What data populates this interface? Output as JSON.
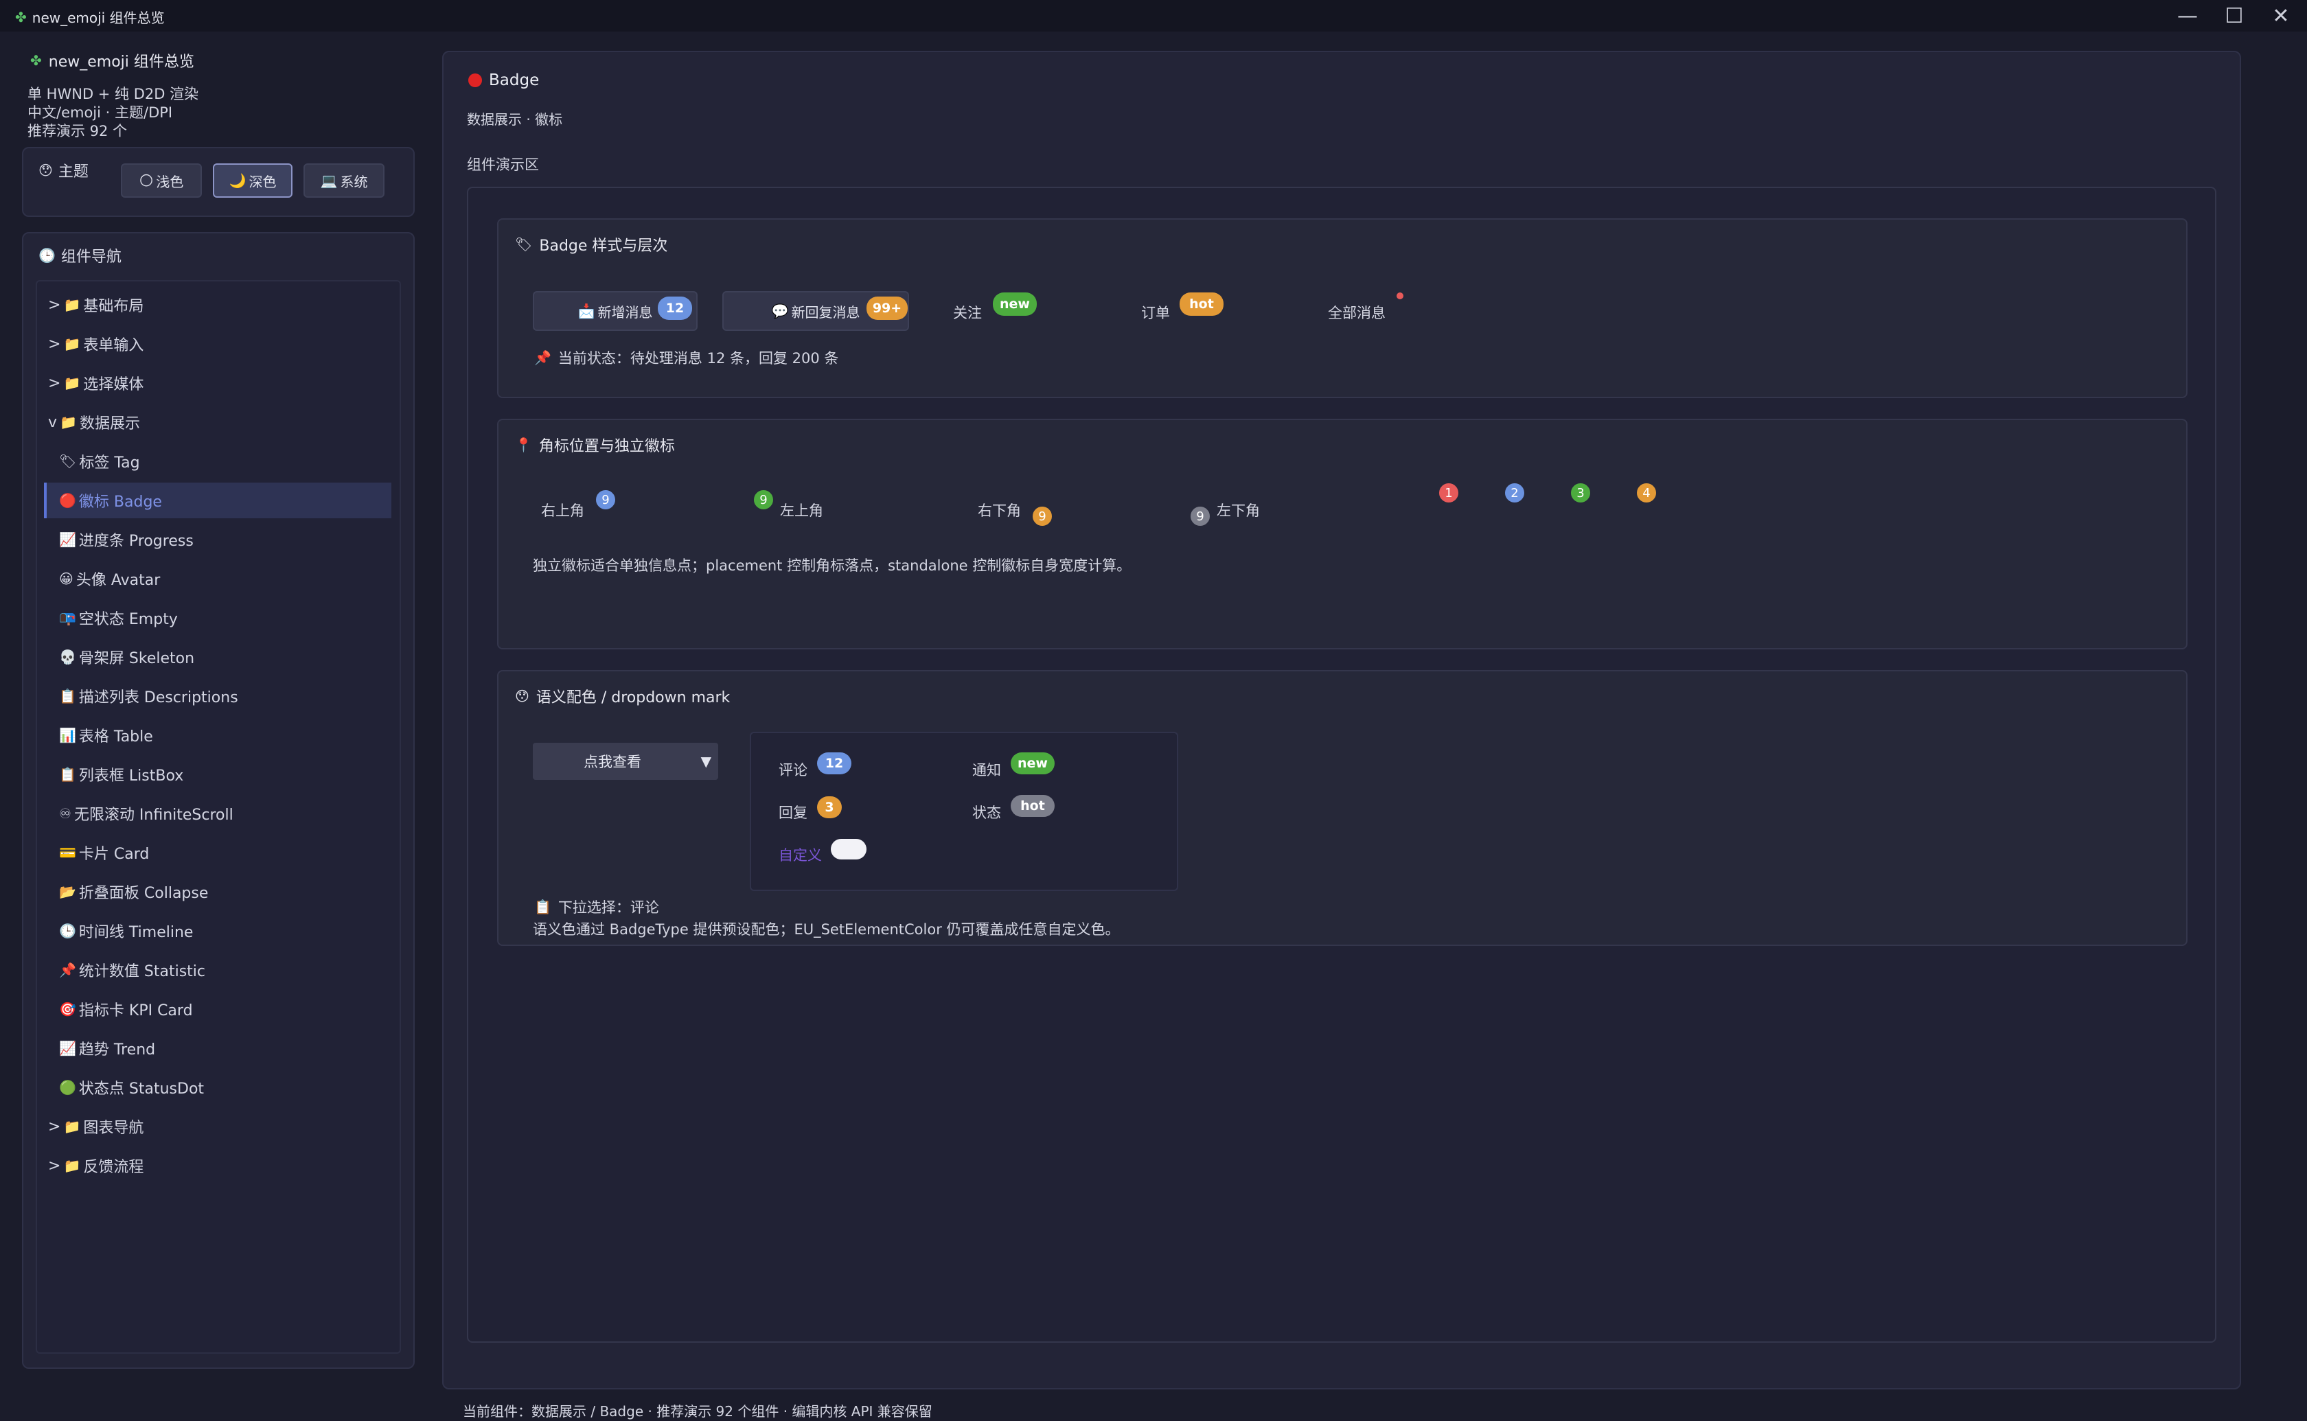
{
  "window": {
    "title": "new_emoji 组件总览",
    "controls": [
      "—",
      "☐",
      "✕"
    ]
  },
  "sidebar": {
    "app_title": "new_emoji 组件总览",
    "info_lines": [
      "单 HWND + 纯 D2D 渲染",
      "中文/emoji · 主题/DPI",
      "推荐演示 92 个"
    ],
    "theme": {
      "label": "主题",
      "options": [
        {
          "label": "浅色",
          "icon": "🌕"
        },
        {
          "label": "深色",
          "icon": "🌙"
        },
        {
          "label": "系统",
          "icon": "💻"
        }
      ],
      "selected": "深色"
    },
    "nav_title": "组件导航",
    "groups": [
      {
        "label": "基础布局",
        "prefix": ">"
      },
      {
        "label": "表单输入",
        "prefix": ">"
      },
      {
        "label": "选择媒体",
        "prefix": ">"
      },
      {
        "label": "数据展示",
        "prefix": "v"
      }
    ],
    "items": [
      {
        "icon": "🏷",
        "label": "标签 Tag"
      },
      {
        "icon": "🔴",
        "label": "徽标 Badge"
      },
      {
        "icon": "📈",
        "label": "进度条 Progress"
      },
      {
        "icon": "😀",
        "label": "头像 Avatar"
      },
      {
        "icon": "📭",
        "label": "空状态 Empty"
      },
      {
        "icon": "💀",
        "label": "骨架屏 Skeleton"
      },
      {
        "icon": "📋",
        "label": "描述列表 Descriptions"
      },
      {
        "icon": "📊",
        "label": "表格 Table"
      },
      {
        "icon": "📋",
        "label": "列表框 ListBox"
      },
      {
        "icon": "♾",
        "label": "无限滚动 InfiniteScroll"
      },
      {
        "icon": "💳",
        "label": "卡片 Card"
      },
      {
        "icon": "📂",
        "label": "折叠面板 Collapse"
      },
      {
        "icon": "🕒",
        "label": "时间线 Timeline"
      },
      {
        "icon": "📌",
        "label": "统计数值 Statistic"
      },
      {
        "icon": "🎯",
        "label": "指标卡 KPI Card"
      },
      {
        "icon": "📈",
        "label": "趋势 Trend"
      },
      {
        "icon": "🟢",
        "label": "状态点 StatusDot"
      }
    ],
    "tail_groups": [
      {
        "label": "图表导航",
        "prefix": ">"
      },
      {
        "label": "反馈流程",
        "prefix": ">"
      }
    ]
  },
  "main": {
    "title": "Badge",
    "subtitle": "数据展示 · 徽标",
    "demo_area_label": "组件演示区",
    "section1": {
      "title": "Badge 样式与层次",
      "items": [
        {
          "label": "新增消息",
          "badge": "12",
          "color": "#6b93e0"
        },
        {
          "label": "新回复消息",
          "badge": "99+",
          "color": "#e39a36"
        },
        {
          "label": "关注",
          "badge": "new",
          "color": "#4cac3e"
        },
        {
          "label": "订单",
          "badge": "hot",
          "color": "#e39a36"
        },
        {
          "label": "全部消息",
          "badge": "",
          "color": "#e85a5a"
        }
      ],
      "status": "当前状态：待处理消息 12 条，回复 200 条"
    },
    "section2": {
      "title": "角标位置与独立徽标",
      "positions": [
        {
          "label": "右上角",
          "badge": "9",
          "color": "#6b93e0"
        },
        {
          "label": "左上角",
          "badge": "9",
          "color": "#4cac3e"
        },
        {
          "label": "右下角",
          "badge": "9",
          "color": "#e39a36"
        },
        {
          "label": "左下角",
          "badge": "9",
          "color": "#7d7f8c"
        }
      ],
      "standalone": [
        {
          "value": "1",
          "color": "#e85a5a"
        },
        {
          "value": "2",
          "color": "#6b93e0"
        },
        {
          "value": "3",
          "color": "#4cac3e"
        },
        {
          "value": "4",
          "color": "#e39a36"
        }
      ],
      "note": "独立徽标适合单独信息点；placement 控制角标落点，standalone 控制徽标自身宽度计算。"
    },
    "section3": {
      "title": "语义配色 / dropdown mark",
      "dropdown_label": "点我查看",
      "dropdown_arrow": "▼",
      "menu": [
        {
          "label": "评论",
          "badge": "12",
          "color": "#6b93e0"
        },
        {
          "label": "通知",
          "badge": "new",
          "color": "#4cac3e"
        },
        {
          "label": "回复",
          "badge": "3",
          "color": "#e39a36"
        },
        {
          "label": "状态",
          "badge": "hot",
          "color": "#7d7f8c"
        },
        {
          "label": "自定义",
          "badge": "",
          "color": "#f2f2f7"
        }
      ],
      "selection": "下拉选择：评论",
      "note": "语义色通过 BadgeType 提供预设配色；EU_SetElementColor 仍可覆盖成任意自定义色。"
    },
    "footer": "当前组件：数据展示 / Badge · 推荐演示 92 个组件 · 编辑内核 API 兼容保留"
  }
}
